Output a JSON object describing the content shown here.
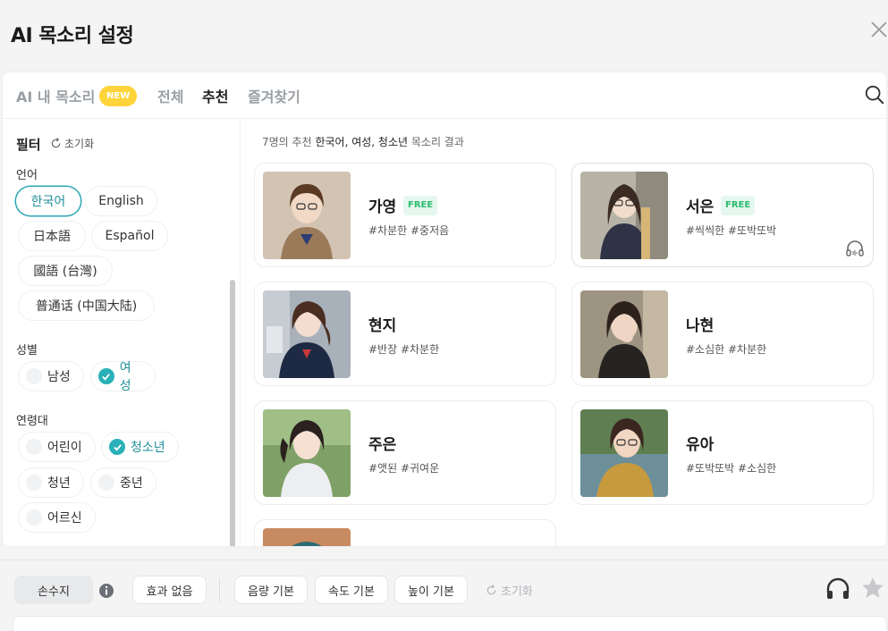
{
  "header": {
    "title": "AI 목소리 설정"
  },
  "tabs": {
    "my_voice": "AI 내 목소리",
    "new_badge": "NEW",
    "all": "전체",
    "recommend": "추천",
    "favorites": "즐겨찾기"
  },
  "filter": {
    "title": "필터",
    "reset": "초기화",
    "language_label": "언어",
    "languages": [
      "한국어",
      "English",
      "日本語",
      "Español",
      "國語 (台灣)",
      "普通话 (中国大陆)"
    ],
    "selected_language": "한국어",
    "gender_label": "성별",
    "genders": [
      "남성",
      "여성"
    ],
    "age_label": "연령대",
    "ages": [
      "어린이",
      "청소년",
      "청년",
      "중년",
      "어르신"
    ]
  },
  "results": {
    "count": "7명의 추천",
    "query": "한국어, 여성, 청소년",
    "suffix": "목소리 결과"
  },
  "voices": [
    {
      "name": "가영",
      "free": "FREE",
      "tags": "#차분한 #중저음"
    },
    {
      "name": "서은",
      "free": "FREE",
      "tags": "#씩씩한 #또박또박"
    },
    {
      "name": "현지",
      "tags": "#반장 #차분한"
    },
    {
      "name": "나현",
      "tags": "#소심한 #차분한"
    },
    {
      "name": "주은",
      "tags": "#앳된 #귀여운"
    },
    {
      "name": "유아",
      "tags": "#또박또박 #소심한"
    }
  ],
  "bottom": {
    "sign": "손수지",
    "effect": "효과 없음",
    "volume": "음량 기본",
    "speed": "속도 기본",
    "pitch": "높이 기본",
    "reset": "초기화"
  },
  "colors": {
    "accent": "#2ab0b8",
    "new_badge": "#ffd43b",
    "free_badge": "#2dbb6f"
  }
}
